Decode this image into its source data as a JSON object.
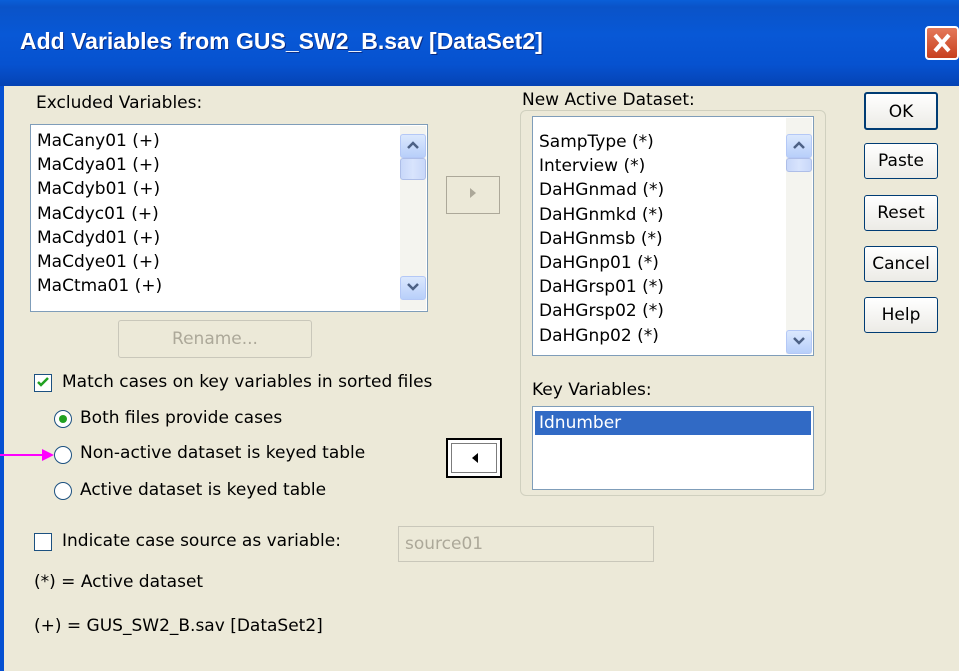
{
  "window": {
    "title": "Add Variables from GUS_SW2_B.sav [DataSet2]",
    "close_glyph": "✕"
  },
  "excluded": {
    "label": "Excluded Variables:",
    "items": [
      "MaCany01 (+)",
      "MaCdya01 (+)",
      "MaCdyb01 (+)",
      "MaCdyc01 (+)",
      "MaCdyd01 (+)",
      "MaCdye01 (+)",
      "MaCtma01 (+)"
    ]
  },
  "new_active": {
    "label": "New Active Dataset:",
    "items": [
      "SampType (*)",
      "Interview (*)",
      "DaHGnmad (*)",
      "DaHGnmkd (*)",
      "DaHGnmsb (*)",
      "DaHGnp01 (*)",
      "DaHGrsp01 (*)",
      "DaHGrsp02 (*)",
      "DaHGnp02 (*)"
    ]
  },
  "key_variables": {
    "label": "Key Variables:",
    "items": [
      "Idnumber"
    ]
  },
  "buttons": {
    "ok": "OK",
    "paste": "Paste",
    "reset": "Reset",
    "cancel": "Cancel",
    "help": "Help",
    "rename": "Rename...",
    "move_right": "▶",
    "move_left": "◀"
  },
  "match": {
    "checkbox_label": "Match cases on key variables in sorted files",
    "checked": true,
    "options": [
      "Both files provide cases",
      "Non-active dataset is keyed table",
      "Active dataset is keyed table"
    ],
    "selected": "Both files provide cases"
  },
  "case_source": {
    "checkbox_label": "Indicate case source as variable:",
    "checked": false,
    "value": "source01"
  },
  "legend": {
    "active": "(*) = Active dataset",
    "non_active": "(+) = GUS_SW2_B.sav [DataSet2]"
  },
  "colors": {
    "titlebar": "#0858d6",
    "dialog_bg": "#ece9d8",
    "selection": "#316ac5",
    "annotation_arrow": "#ff00ff"
  }
}
